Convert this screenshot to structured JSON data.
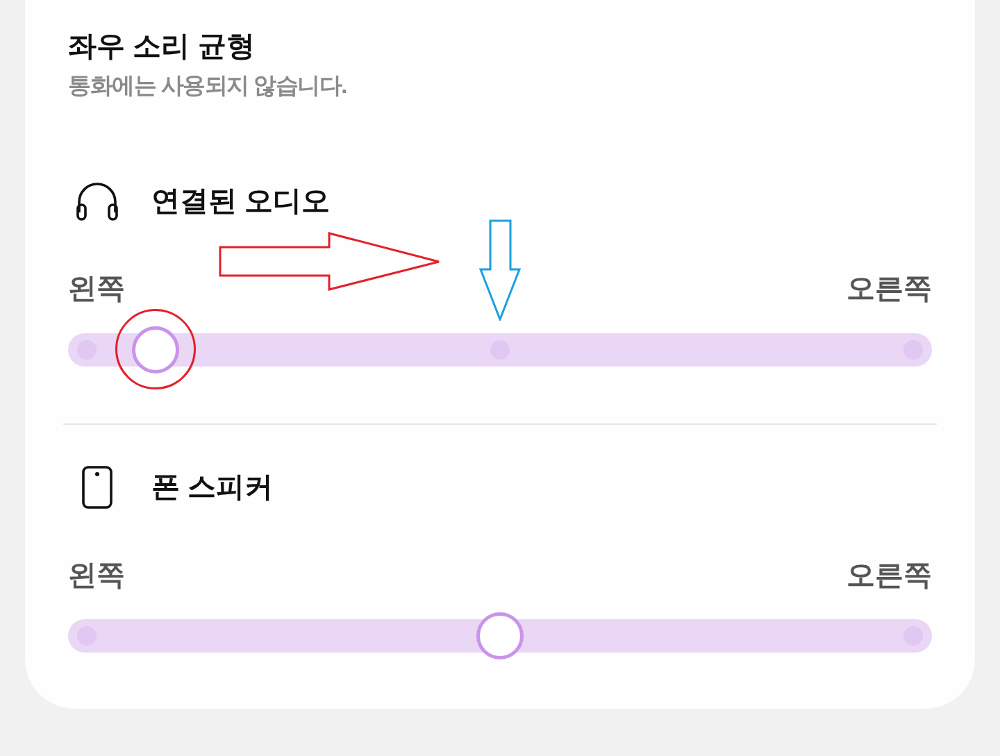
{
  "title": "좌우 소리 균형",
  "subtitle": "통화에는 사용되지 않습니다.",
  "devices": [
    {
      "kind": "headphones",
      "name": "연결된 오디오",
      "left_label": "왼쪽",
      "right_label": "오른쪽",
      "level": 0.083
    },
    {
      "kind": "phone",
      "name": "폰 스피커",
      "left_label": "왼쪽",
      "right_label": "오른쪽",
      "level": 0.5
    }
  ]
}
